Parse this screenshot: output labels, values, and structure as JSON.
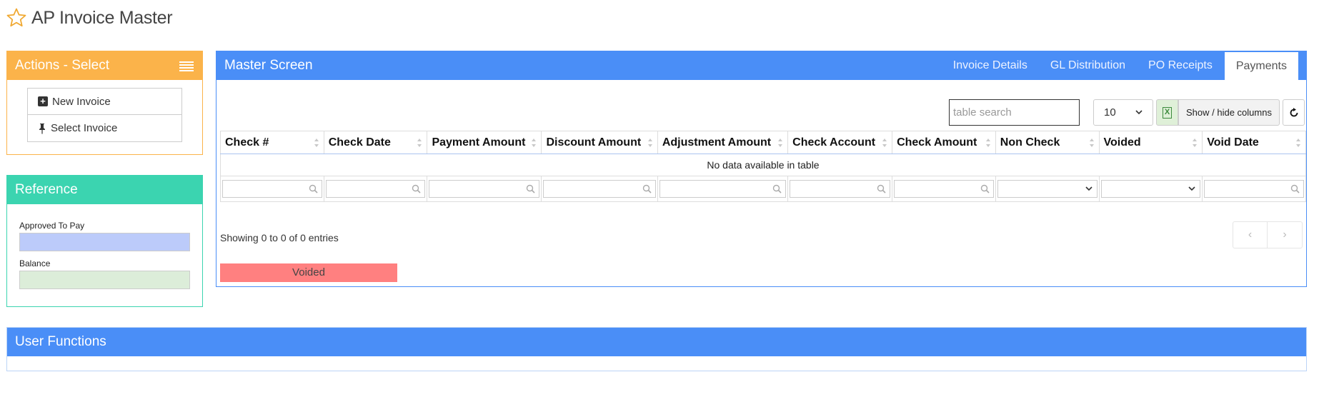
{
  "page": {
    "title": "AP Invoice Master"
  },
  "actions": {
    "title": "Actions - Select",
    "items": [
      {
        "label": "New Invoice",
        "icon": "plus-square-icon"
      },
      {
        "label": "Select Invoice",
        "icon": "pin-icon"
      }
    ]
  },
  "reference": {
    "title": "Reference",
    "approved_label": "Approved To Pay",
    "approved_value": "",
    "balance_label": "Balance",
    "balance_value": ""
  },
  "master": {
    "title": "Master Screen",
    "tabs": [
      {
        "label": "Invoice Details",
        "active": false
      },
      {
        "label": "GL Distribution",
        "active": false
      },
      {
        "label": "PO Receipts",
        "active": false
      },
      {
        "label": "Payments",
        "active": true
      }
    ],
    "search_placeholder": "table search",
    "page_size": "10",
    "colvis_label": "Show / hide columns",
    "columns": [
      "Check #",
      "Check Date",
      "Payment Amount",
      "Discount Amount",
      "Adjustment Amount",
      "Check Account",
      "Check Amount",
      "Non Check",
      "Voided",
      "Void Date"
    ],
    "filter_types": [
      "text",
      "text",
      "text",
      "text",
      "text",
      "text",
      "text",
      "select",
      "select",
      "text"
    ],
    "empty_message": "No data available in table",
    "info": "Showing 0 to 0 of 0 entries",
    "pager": {
      "prev": "‹",
      "next": "›"
    },
    "legend_voided": "Voided"
  },
  "user_functions": {
    "title": "User Functions"
  },
  "colors": {
    "actions": "#fbb34a",
    "reference": "#3bd4b0",
    "master": "#4a8ef7",
    "approved_field": "#bccbfa",
    "balance_field": "#dcedd9",
    "voided": "#ff8080"
  }
}
